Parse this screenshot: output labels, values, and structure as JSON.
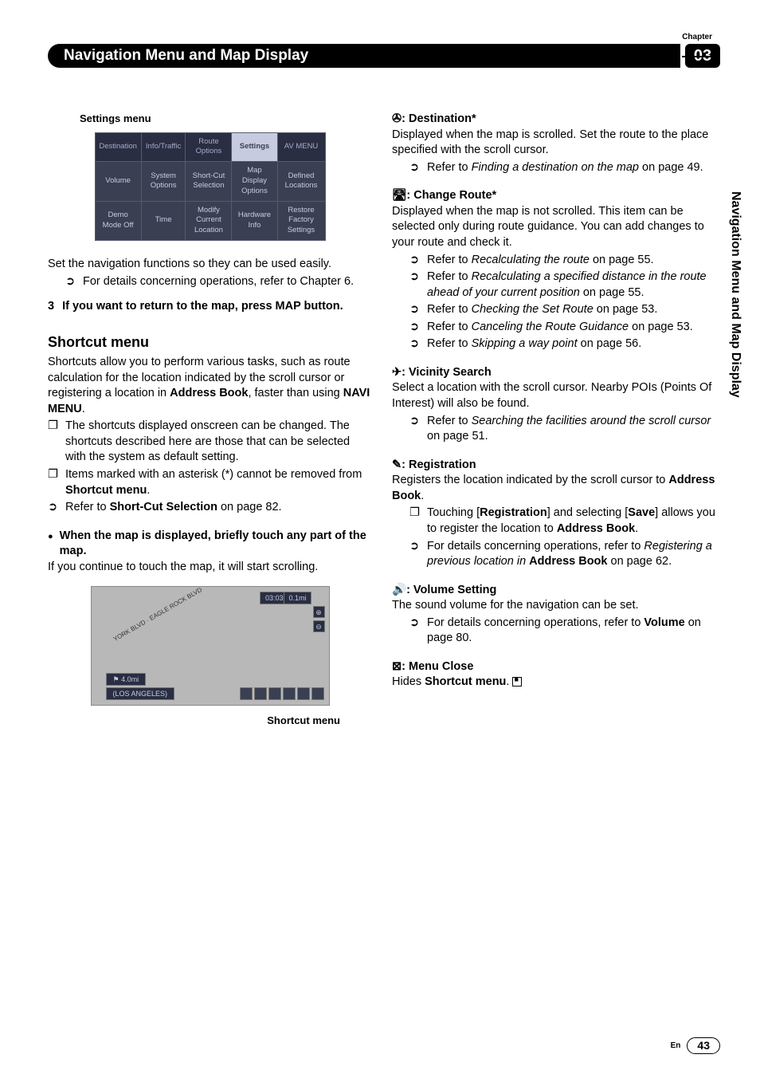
{
  "header": {
    "chapter_label": "Chapter",
    "chapter_num": "03",
    "title": "Navigation Menu and Map Display",
    "side_label": "Navigation Menu and Map Display"
  },
  "left": {
    "settings_heading": "Settings menu",
    "tabs": [
      "Destination",
      "Info/Traffic",
      "Route Options",
      "Settings",
      "AV MENU"
    ],
    "row1": [
      "Volume",
      "System Options",
      "Short-Cut Selection",
      "Map Display Options",
      "Defined Locations"
    ],
    "row2": [
      "Demo Mode Off",
      "Time",
      "Modify Current Location",
      "Hardware Info",
      "Restore Factory Settings"
    ],
    "intro": "Set the navigation functions so they can be used easily.",
    "intro_ref": "For details concerning operations, refer to Chapter 6.",
    "step3_num": "3",
    "step3": "If you want to return to the map, press MAP button.",
    "h_shortcut": "Shortcut menu",
    "shortcut_p1": "Shortcuts allow you to perform various tasks, such as route calculation for the location indicated by the scroll cursor or registering a location in ",
    "shortcut_p1_b1": "Address Book",
    "shortcut_p1_mid": ", faster than using ",
    "shortcut_p1_b2": "NAVI MENU",
    "shortcut_p1_end": ".",
    "sc_b1": "The shortcuts displayed onscreen can be changed. The shortcuts described here are those that can be selected with the system as default setting.",
    "sc_b2a": "Items marked with an asterisk (*) cannot be removed from ",
    "sc_b2b": "Shortcut menu",
    "sc_b2c": ".",
    "sc_b3a": "Refer to ",
    "sc_b3b": "Short-Cut Selection",
    "sc_b3c": " on page 82.",
    "map_lead": "When the map is displayed, briefly touch any part of the map.",
    "map_note": "If you continue to touch the map, it will start scrolling.",
    "map_clock": "03:03",
    "map_scale": "0.1mi",
    "map_dist": "4.0mi",
    "map_city": "(LOS ANGELES)",
    "caption": "Shortcut menu"
  },
  "right": {
    "dest_label": ": Destination*",
    "dest_p": "Displayed when the map is scrolled. Set the route to the place specified with the scroll cursor.",
    "dest_r1": "Finding a destination on the map",
    "dest_r1_end": " on page 49.",
    "route_label": ": Change Route*",
    "route_p": "Displayed when the map is not scrolled. This item can be selected only during route guidance. You can add changes to your route and check it.",
    "route_r1": "Recalculating the route",
    "route_r1_end": " on page 55.",
    "route_r2": "Recalculating a specified distance in the route ahead of your current position",
    "route_r2_end": " on page 55.",
    "route_r3": "Checking the Set Route",
    "route_r3_end": " on page 53.",
    "route_r4": "Canceling the Route Guidance",
    "route_r4_end": " on page 53.",
    "route_r5": "Skipping a way point",
    "route_r5_end": " on page 56.",
    "vic_label": ": Vicinity Search",
    "vic_p": "Select a location with the scroll cursor. Nearby POIs (Points Of Interest) will also be found.",
    "vic_r1": "Searching the facilities around the scroll cursor",
    "vic_r1_end": " on page 51.",
    "reg_label": ": Registration",
    "reg_p1": "Registers the location indicated by the scroll cursor to ",
    "reg_p1b": "Address Book",
    "reg_p1_end": ".",
    "reg_b1a": "Touching [",
    "reg_b1b": "Registration",
    "reg_b1c": "] and selecting [",
    "reg_b1d": "Save",
    "reg_b1e": "] allows you to register the location to ",
    "reg_b1f": "Address Book",
    "reg_b1g": ".",
    "reg_b2a": "For details concerning operations, refer to ",
    "reg_b2b": "Registering a previous location in",
    "reg_b2c": " ",
    "reg_b2d": "Address Book",
    "reg_b2e": " on page 62.",
    "vol_label": ": Volume Setting",
    "vol_p": "The sound volume for the navigation can be set.",
    "vol_b1a": "For details concerning operations, refer to ",
    "vol_b1b": "Volume",
    "vol_b1c": " on page 80.",
    "close_label": ": Menu Close",
    "close_p1": "Hides ",
    "close_p1b": "Shortcut menu",
    "close_p1_end": "."
  },
  "footer": {
    "lang": "En",
    "page": "43"
  }
}
